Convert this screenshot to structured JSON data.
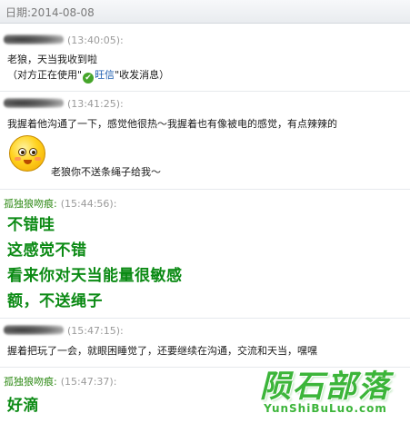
{
  "date_header": "日期:2014-08-08",
  "messages": [
    {
      "sender": "",
      "time": "(13:40:05):",
      "lines": [
        "老狼，天当我收到啦"
      ],
      "status_prefix": "（对方正在使用\"",
      "status_link": "旺信",
      "status_suffix": "\"收发消息）"
    },
    {
      "sender": "",
      "time": "(13:41:25):",
      "lines": [
        "我握着他沟通了一下，感觉他很热～我握着也有像被电的感觉，有点辣辣的"
      ],
      "caption": "老狼你不送条绳子给我～"
    },
    {
      "sender": "孤独狼吻痕:",
      "time": "(15:44:56):",
      "big_lines": [
        "不错哇",
        "这感觉不错",
        "看来你对天当能量很敏感",
        "额，不送绳子"
      ]
    },
    {
      "sender": "",
      "time": "(15:47:15):",
      "lines": [
        "握着把玩了一会，就眼困睡觉了，还要继续在沟通，交流和天当，嘿嘿"
      ]
    },
    {
      "sender": "孤独狼吻痕:",
      "time": "(15:47:37):",
      "big_lines": [
        "好滴"
      ]
    }
  ],
  "watermark": {
    "main": "陨石部落",
    "sub": "YunShiBuLuo.com"
  },
  "colors": {
    "sender_green": "#2f8a16",
    "big_text_green": "#0b8a14",
    "watermark_green": "#3cb53a"
  }
}
